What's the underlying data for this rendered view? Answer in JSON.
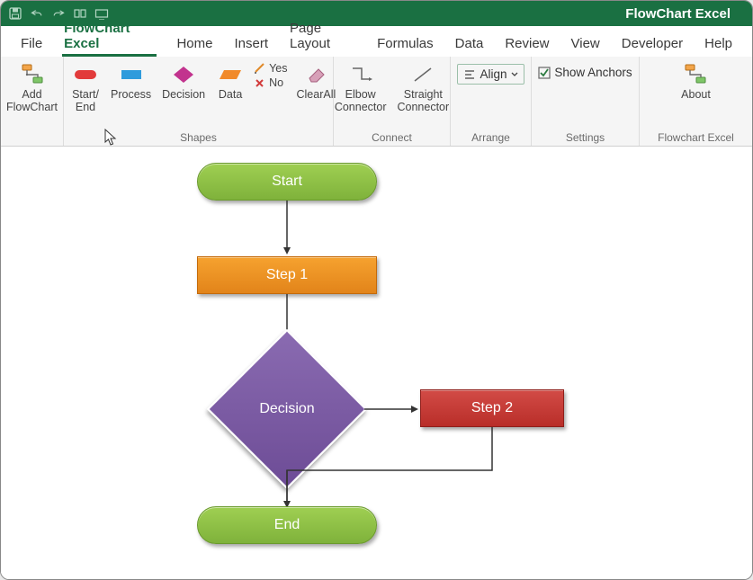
{
  "title": "FlowChart Excel",
  "tabs": [
    {
      "label": "File"
    },
    {
      "label": "FlowChart Excel",
      "active": true
    },
    {
      "label": "Home"
    },
    {
      "label": "Insert"
    },
    {
      "label": "Page Layout"
    },
    {
      "label": "Formulas"
    },
    {
      "label": "Data"
    },
    {
      "label": "Review"
    },
    {
      "label": "View"
    },
    {
      "label": "Developer"
    },
    {
      "label": "Help"
    }
  ],
  "ribbon": {
    "add": {
      "label": "Add\nFlowChart"
    },
    "shapes": {
      "group_label": "Shapes",
      "start": {
        "label": "Start/\nEnd",
        "color": "#e23b3b"
      },
      "process": {
        "label": "Process",
        "color": "#2f9bdc"
      },
      "decision": {
        "label": "Decision",
        "color": "#c2338e"
      },
      "data": {
        "label": "Data",
        "color": "#f18a2b"
      },
      "yes": "Yes",
      "no": "No",
      "clear": {
        "label": "ClearAll"
      }
    },
    "connect": {
      "group_label": "Connect",
      "elbow": {
        "label": "Elbow\nConnector"
      },
      "straight": {
        "label": "Straight\nConnector"
      }
    },
    "arrange": {
      "group_label": "Arrange",
      "align": "Align"
    },
    "settings": {
      "group_label": "Settings",
      "anchors": "Show Anchors"
    },
    "about": {
      "group_label": "Flowchart Excel",
      "label": "About"
    }
  },
  "flow": {
    "start": "Start",
    "step1": "Step 1",
    "decision": "Decision",
    "step2": "Step 2",
    "end": "End"
  }
}
